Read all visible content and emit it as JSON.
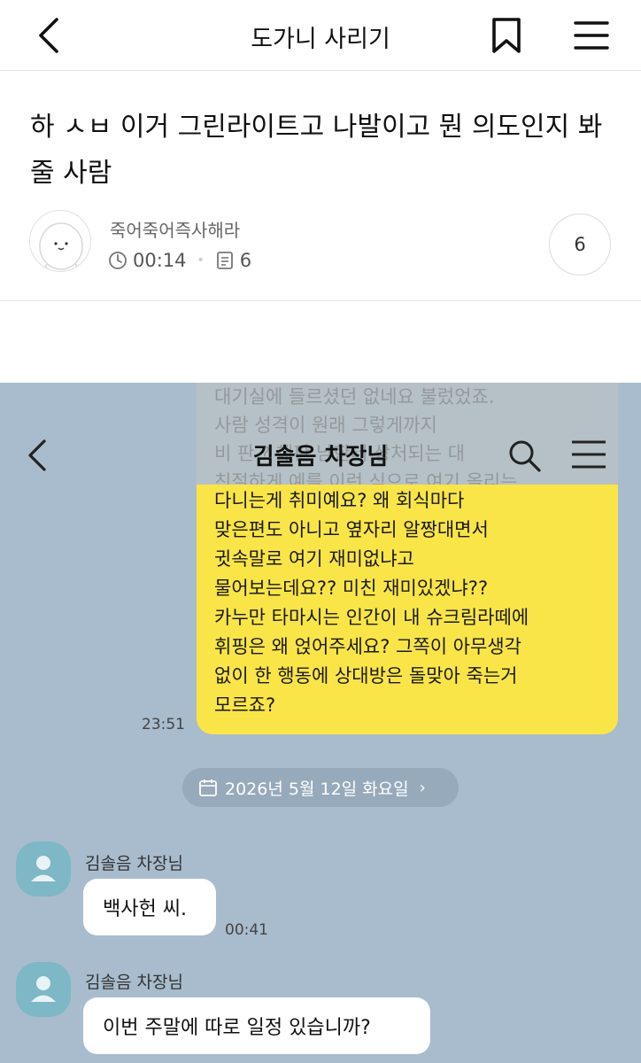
{
  "header": {
    "title": "도가니 사리기"
  },
  "post": {
    "title": "하 ㅅㅂ 이거 그린라이트고 나발이고 뭔 의도인지 봐줄 사람",
    "author": "죽어죽어즉사해라",
    "duration": "00:14",
    "comment_count": "6",
    "comment_badge": "6"
  },
  "chat": {
    "room_title": "김솔음 차장님",
    "ghost_text": "대기실에 들르셨던 없네요 불렀었죠.\n사람 성격이 원래 그렇게까지\n비 판 ? 해판 남한테 상처되는 대\n친절하게 예를 이런 식으로 여기 올리는",
    "sent_message": "다니는게 취미예요? 왜 회식마다\n맞은편도 아니고 옆자리 알짱대면서\n귓속말로 여기 재미없냐고\n물어보는데요?? 미친 재미있겠냐??\n카누만 타마시는 인간이 내 슈크림라떼에\n휘핑은 왜 얹어주세요? 그쪽이 아무생각\n없이 한 행동에 상대방은 돌맞아 죽는거\n모르죠?",
    "sent_time": "23:51",
    "date_divider": "2026년 5월 12일 화요일",
    "messages": [
      {
        "sender": "김솔음 차장님",
        "text": "백사헌 씨.",
        "time": "00:41"
      },
      {
        "sender": "김솔음 차장님",
        "text": "이번 주말에 따로 일정 있습니까?"
      }
    ]
  }
}
